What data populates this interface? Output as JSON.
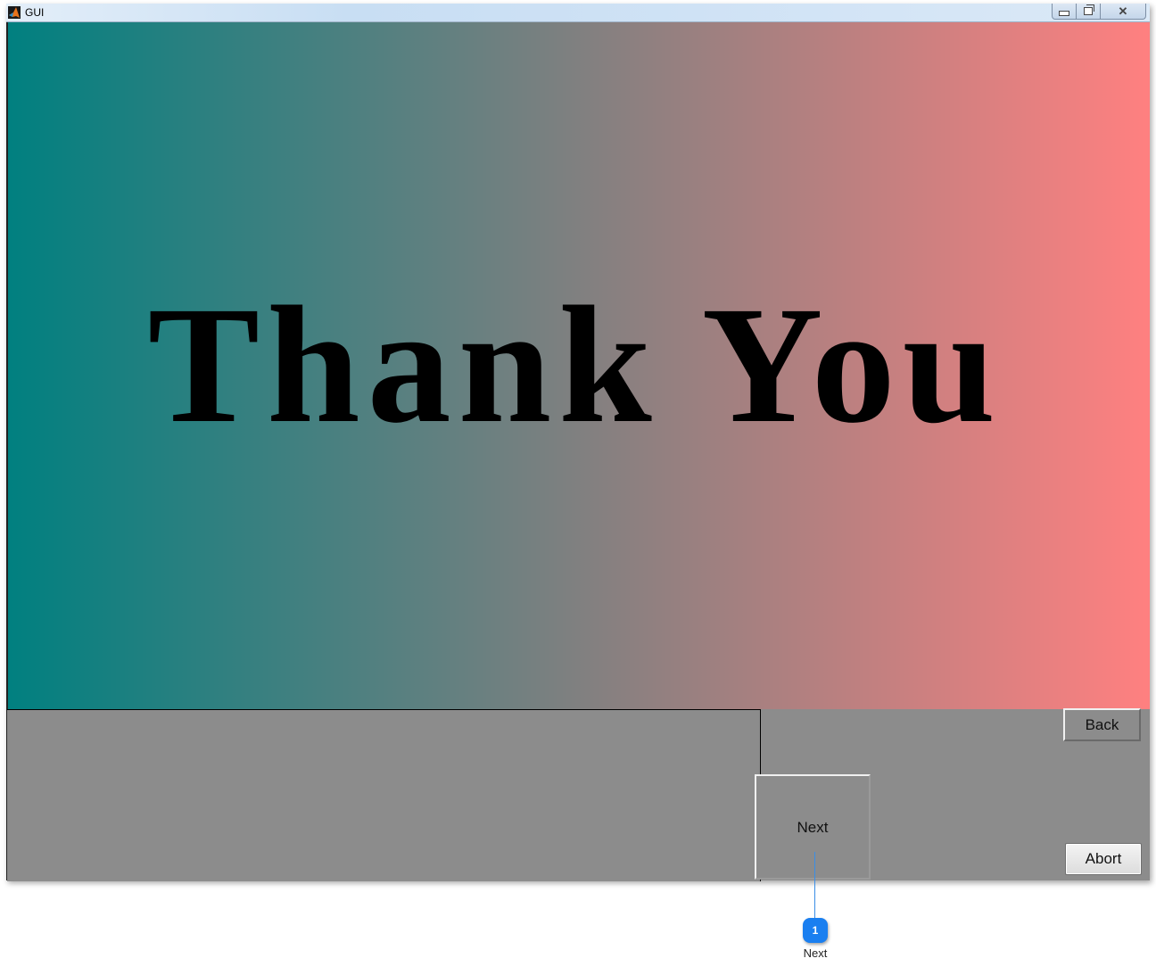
{
  "window": {
    "title": "GUI",
    "icon": "matlab-icon",
    "controls": {
      "minimize": "minimize-icon",
      "maximize": "restore-icon",
      "close": "✕"
    }
  },
  "banner": {
    "text": "Thank You",
    "gradient_start": "#008080",
    "gradient_mid": "#808080",
    "gradient_end": "#ff8080"
  },
  "buttons": {
    "back": "Back",
    "next": "Next",
    "abort": "Abort"
  },
  "annotation": {
    "number": "1",
    "label": "Next",
    "color": "#1a7ff0"
  }
}
